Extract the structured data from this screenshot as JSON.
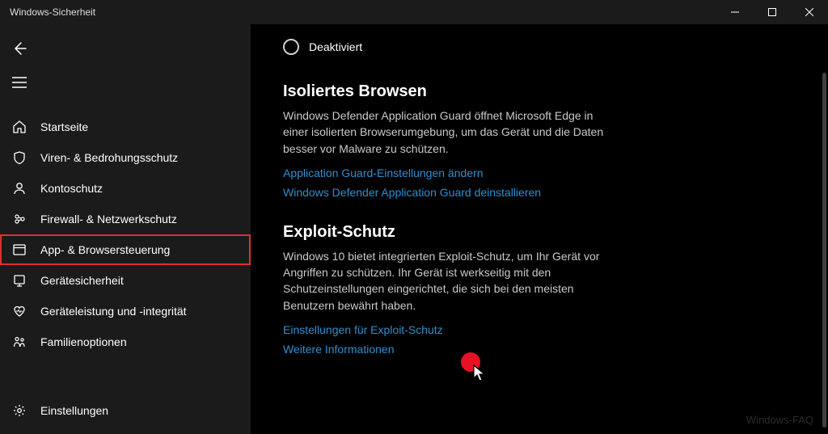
{
  "window": {
    "title": "Windows-Sicherheit"
  },
  "sidebar": {
    "items": [
      {
        "label": "Startseite"
      },
      {
        "label": "Viren- & Bedrohungsschutz"
      },
      {
        "label": "Kontoschutz"
      },
      {
        "label": "Firewall- & Netzwerkschutz"
      },
      {
        "label": "App- & Browsersteuerung"
      },
      {
        "label": "Gerätesicherheit"
      },
      {
        "label": "Geräteleistung und -integrität"
      },
      {
        "label": "Familienoptionen"
      }
    ],
    "settings_label": "Einstellungen"
  },
  "content": {
    "radio_label": "Deaktiviert",
    "section1": {
      "title": "Isoliertes Browsen",
      "desc": "Windows Defender Application Guard öffnet Microsoft Edge in einer isolierten Browserumgebung, um das Gerät und die Daten besser vor Malware zu schützen.",
      "link1": "Application Guard-Einstellungen ändern",
      "link2": "Windows Defender Application Guard deinstallieren"
    },
    "section2": {
      "title": "Exploit-Schutz",
      "desc": "Windows 10 bietet integrierten Exploit-Schutz, um Ihr Gerät vor Angriffen zu schützen. Ihr Gerät ist werkseitig mit den Schutzeinstellungen eingerichtet, die sich bei den meisten Benutzern bewährt haben.",
      "link1": "Einstellungen für Exploit-Schutz",
      "link2": "Weitere Informationen"
    }
  },
  "watermark": "Windows-FAQ"
}
